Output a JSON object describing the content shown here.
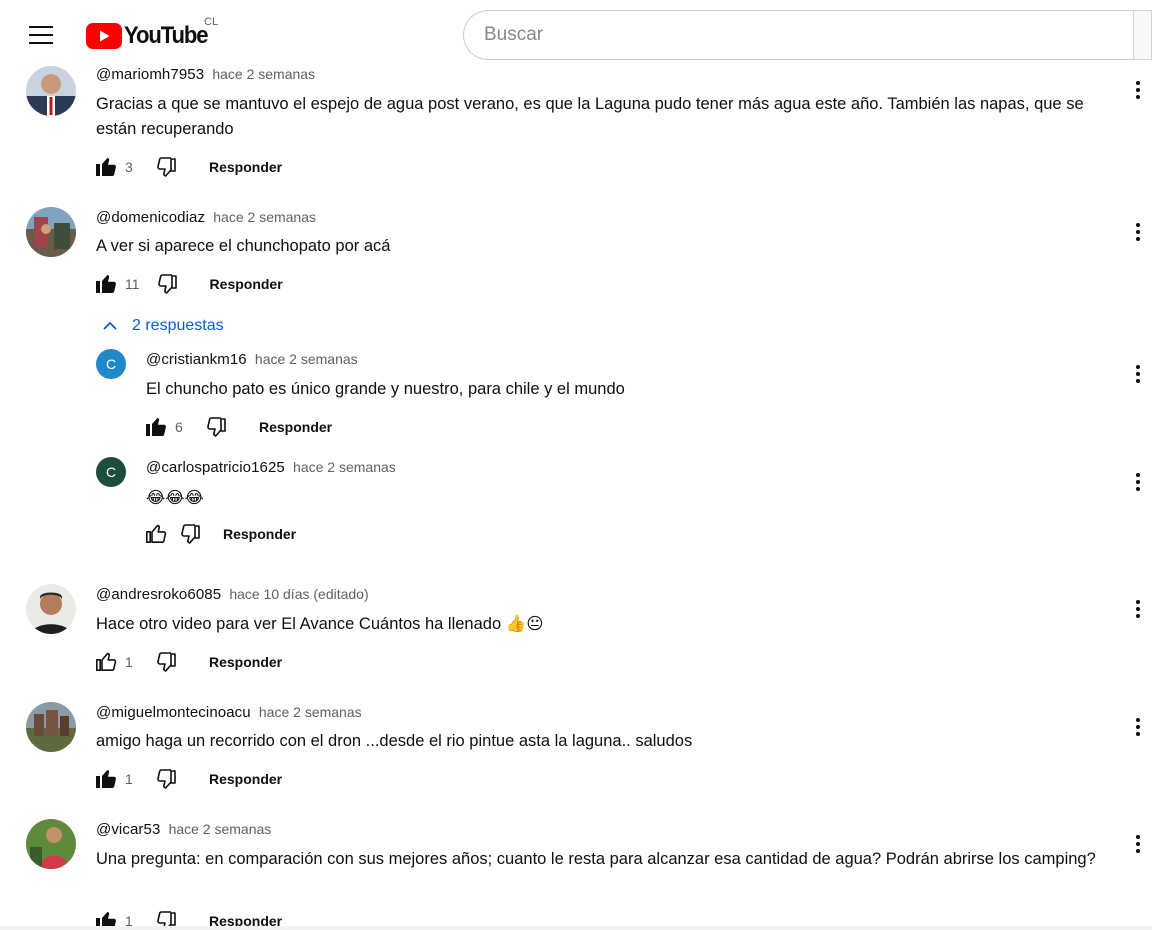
{
  "header": {
    "logo_text": "YouTube",
    "country_code": "CL",
    "search_placeholder": "Buscar"
  },
  "colors": {
    "brand_red": "#FF0000",
    "link_blue": "#065fd4",
    "text_secondary": "#606060"
  },
  "comments": [
    {
      "author": "@mariomh7953",
      "time": "hace 2 semanas",
      "text": "Gracias a que se mantuvo el espejo de agua post verano, es que la Laguna pudo tener más agua este año. También las napas, que se están recuperando",
      "likes": "3",
      "liked": true,
      "reply_label": "Responder"
    },
    {
      "author": "@domenicodiaz",
      "time": "hace 2 semanas",
      "text": "A ver si aparece el chunchopato por acá",
      "likes": "11",
      "liked": true,
      "reply_label": "Responder",
      "replies_toggle": "2 respuestas",
      "replies": [
        {
          "author": "@cristiankm16",
          "initial": "C",
          "avatar_color": "#1e88c9",
          "time": "hace 2 semanas",
          "text": "El chuncho pato es único grande y nuestro, para chile y el mundo",
          "likes": "6",
          "liked": true,
          "reply_label": "Responder"
        },
        {
          "author": "@carlospatricio1625",
          "initial": "C",
          "avatar_color": "#1b4d3e",
          "time": "hace 2 semanas",
          "text": "😂😂😂",
          "likes": "",
          "liked": false,
          "reply_label": "Responder"
        }
      ]
    },
    {
      "author": "@andresroko6085",
      "time": "hace 10 días (editado)",
      "text": "Hace otro video para ver El Avance Cuántos ha llenado 👍😐",
      "likes": "1",
      "liked": false,
      "reply_label": "Responder"
    },
    {
      "author": "@miguelmontecinoacu",
      "time": "hace 2 semanas",
      "text": "amigo haga un recorrido con el dron ...desde el rio pintue asta la laguna.. saludos",
      "likes": "1",
      "liked": true,
      "reply_label": "Responder"
    },
    {
      "author": "@vicar53",
      "time": "hace 2 semanas",
      "text": "Una pregunta: en comparación con sus mejores años; cuanto le resta para alcanzar esa cantidad de agua? Podrán abrirse los camping?",
      "likes": "1",
      "liked": true,
      "reply_label": "Responder"
    }
  ]
}
